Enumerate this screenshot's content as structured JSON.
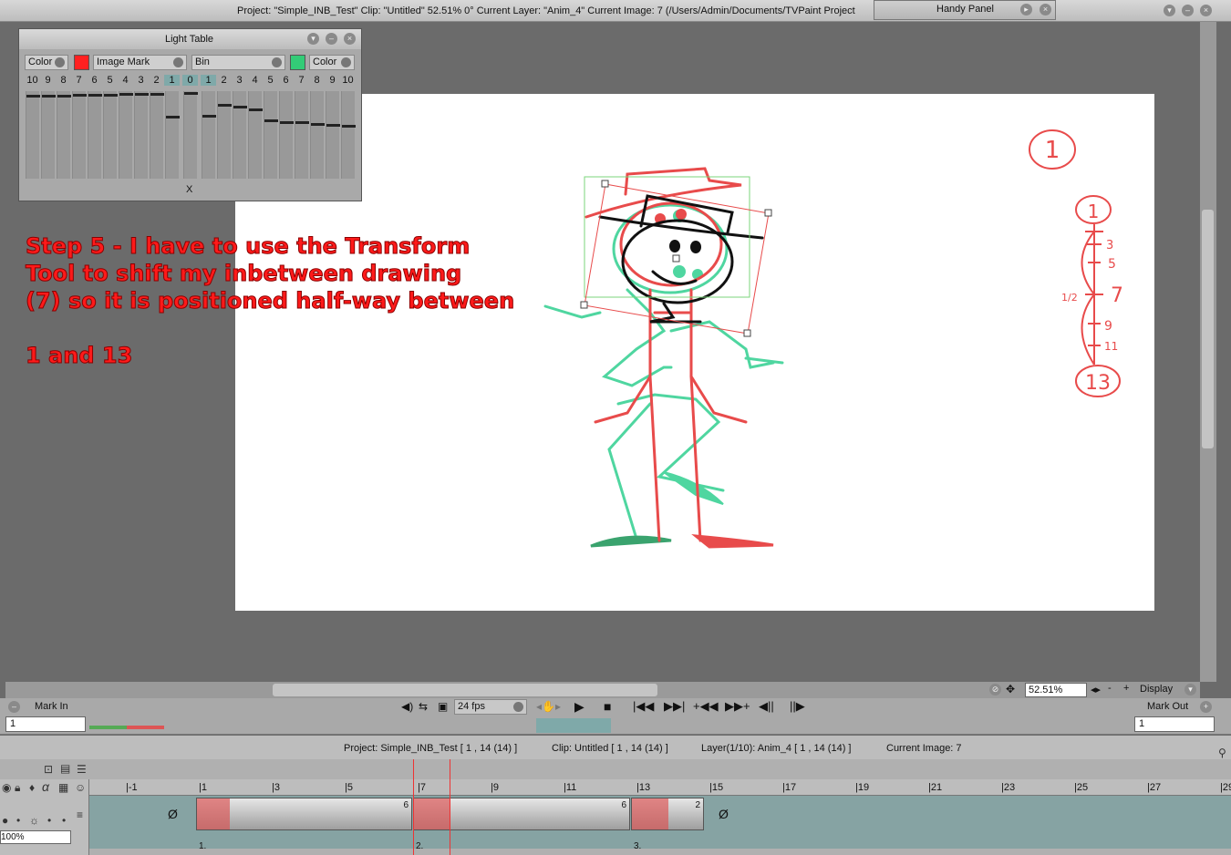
{
  "titlebar": {
    "title": "Project:  \"Simple_INB_Test\"  Clip: \"Untitled\"   52.51%   0°  Current Layer: \"Anim_4\"  Current Image: 7 (/Users/Admin/Documents/TVPaint Project",
    "handy_panel": "Handy Panel"
  },
  "light_table": {
    "title": "Light Table",
    "left_mode": "Color",
    "left_color": "#ff2020",
    "mark": "Image Mark",
    "bin": "Bin",
    "right_color": "#33cc77",
    "right_mode": "Color",
    "numbers": [
      "10",
      "9",
      "8",
      "7",
      "6",
      "5",
      "4",
      "3",
      "2",
      "1",
      "0",
      "1",
      "2",
      "3",
      "4",
      "5",
      "6",
      "7",
      "8",
      "9",
      "10"
    ],
    "levels": [
      0.96,
      0.96,
      0.96,
      0.97,
      0.97,
      0.97,
      0.98,
      0.98,
      0.98,
      0.7,
      0.99,
      0.71,
      0.85,
      0.82,
      0.79,
      0.65,
      0.63,
      0.63,
      0.61,
      0.6,
      0.59
    ],
    "center_mark": "X"
  },
  "annotation": {
    "step_text": "Step 5 - I have to use the Transform\nTool to shift my inbetween drawing\n(7) so it is positioned half-way between\n\n1 and 13"
  },
  "canvas": {
    "top_key_label": "1",
    "chart_labels": [
      "1",
      "3",
      "5",
      "7",
      "9",
      "11",
      "13"
    ],
    "half_label": "1/2"
  },
  "zoom": {
    "value": "52.51%",
    "minus": "-",
    "plus": "+",
    "display_label": "Display"
  },
  "controls": {
    "mark_in": "Mark In",
    "mark_out": "Mark Out",
    "mark_in_value": "1",
    "mark_out_value": "1",
    "fps": "24 fps"
  },
  "info": {
    "project": "Project: Simple_INB_Test [ 1 , 14  (14) ]",
    "clip": "Clip: Untitled [ 1 , 14  (14) ]",
    "layer": "Layer(1/10): Anim_4 [ 1 , 14  (14) ]",
    "current_image": "Current Image: 7"
  },
  "timeline": {
    "ruler_ticks": [
      "-1",
      "1",
      "3",
      "5",
      "7",
      "9",
      "11",
      "13",
      "15",
      "17",
      "19",
      "21",
      "23",
      "25",
      "27",
      "29"
    ],
    "opacity": "100%",
    "instances": [
      {
        "index": "1.",
        "duration": "6"
      },
      {
        "index": "2.",
        "duration": "6"
      },
      {
        "index": "3.",
        "duration": "2"
      }
    ],
    "empty_symbol": "Ø"
  },
  "colors": {
    "red_drawing": "#e84b4b",
    "green_drawing": "#4fd6a0",
    "black_drawing": "#111111",
    "ui_gray": "#a9a9a9",
    "track_teal": "#86a3a3"
  }
}
